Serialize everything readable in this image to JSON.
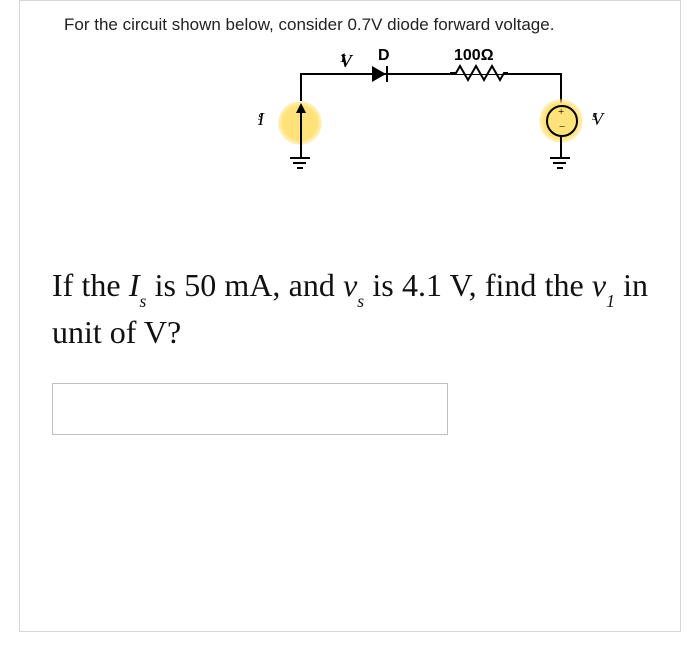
{
  "problem": {
    "intro": "For the circuit shown below, consider 0.7V diode forward voltage."
  },
  "circuit": {
    "labels": {
      "current_source": "I",
      "current_source_sub": "s",
      "v1": "V",
      "v1_sub": "1",
      "diode": "D",
      "resistor": "100Ω",
      "voltage_source": "V",
      "voltage_source_sub": "s",
      "plus": "+",
      "minus": "−"
    }
  },
  "question": {
    "t1": "If the ",
    "var1": "I",
    "var1_sub": "s",
    "t2": " is 50 mA, and ",
    "var2": "v",
    "var2_sub": "s",
    "t3": " is 4.1 V, find the ",
    "var3": "v",
    "var3_sub": "1",
    "t4": " in unit of V?"
  },
  "answer": {
    "value": ""
  }
}
